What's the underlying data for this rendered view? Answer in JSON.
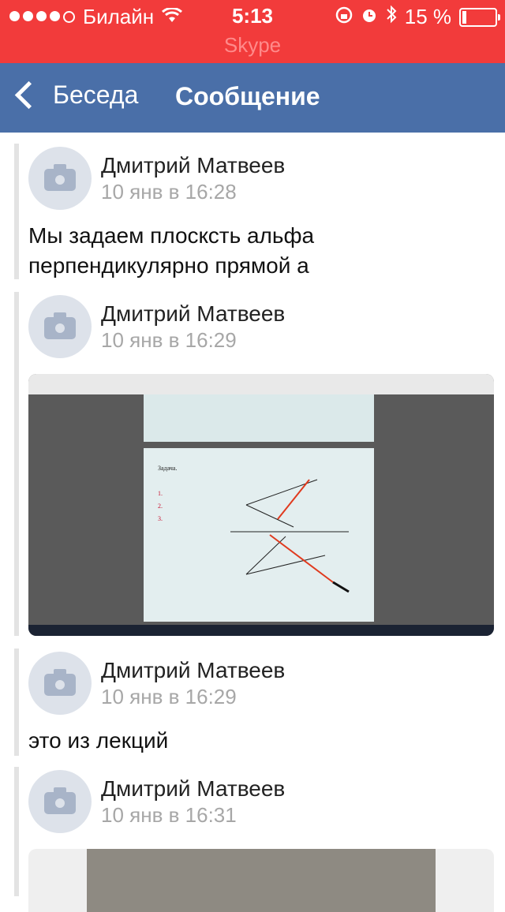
{
  "status_bar": {
    "carrier": "Билайн",
    "time": "5:13",
    "battery_percent": "15 %",
    "app_label": "Skype",
    "icons": [
      "signal-dots",
      "wifi-icon",
      "orientation-lock-icon",
      "alarm-icon",
      "bluetooth-icon",
      "battery-icon"
    ]
  },
  "nav": {
    "back_label": "Беседа",
    "title": "Сообщение"
  },
  "posts": [
    {
      "author": "Дмитрий Матвеев",
      "date": "10 янв в 16:28",
      "text": "Мы задаем плоскcть альфа перпендикулярно прямой а"
    },
    {
      "author": "Дмитрий Матвеев",
      "date": "10 янв в 16:29",
      "attachment": "screenshot"
    },
    {
      "author": "Дмитрий Матвеев",
      "date": "10 янв в 16:29",
      "text": "это из лекций"
    },
    {
      "author": "Дмитрий Матвеев",
      "date": "10 янв в 16:31",
      "attachment": "photo"
    }
  ],
  "colors": {
    "status_bar": "#f23b3b",
    "nav_bar": "#4a6fa8",
    "date_text": "#a7a7a7"
  }
}
